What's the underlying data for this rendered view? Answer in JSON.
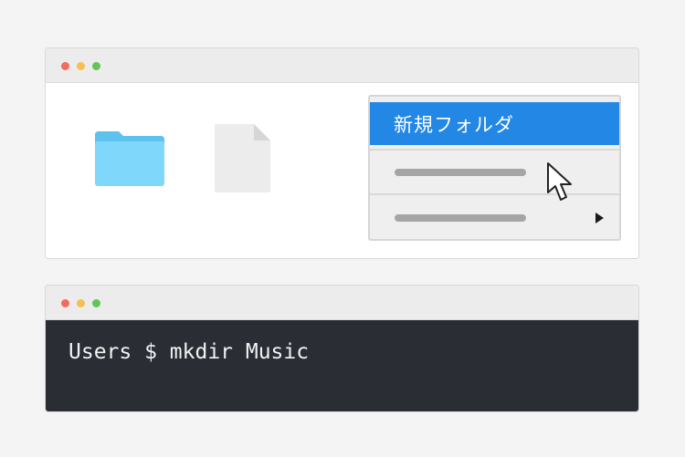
{
  "colors": {
    "page_bg": "#f4f4f4",
    "titlebar": "#ececec",
    "dot_red": "#f26b5f",
    "dot_yellow": "#f6bf4f",
    "dot_green": "#62c554",
    "folder": "#7fd7fb",
    "folder_tab": "#5ec2ef",
    "file": "#ececec",
    "menu_selected": "#2387e6",
    "terminal_bg": "#2a2d34",
    "terminal_text": "#f2f2f2"
  },
  "finder": {
    "context_menu": {
      "items": [
        {
          "label": "新規フォルダ",
          "selected": true
        },
        {
          "label": "",
          "has_submenu": false
        },
        {
          "label": "",
          "has_submenu": true
        }
      ]
    }
  },
  "terminal": {
    "command_line": "Users $ mkdir Music"
  }
}
